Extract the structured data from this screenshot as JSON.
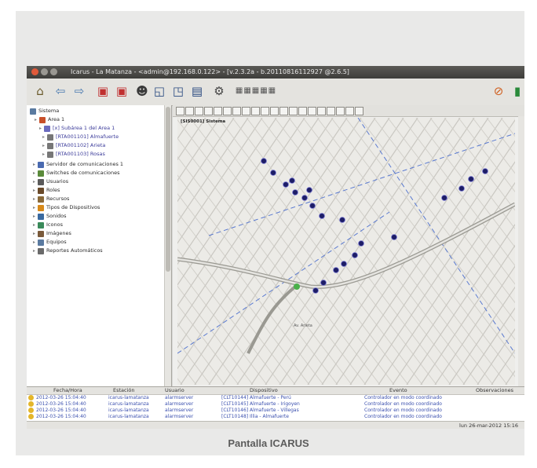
{
  "window": {
    "title": "Icarus - La Matanza - <admin@192.168.0.122> - [v.2.3.2a - b.20110816112927 @2.6.5]",
    "close_color": "#e05a3a",
    "min_color": "#9a9892",
    "max_color": "#9a9892"
  },
  "tree": {
    "root": "Sistema",
    "items": [
      {
        "label": "Area 1",
        "color": "#c8502a"
      },
      {
        "label": "[x] Subárea 1 del Area 1",
        "color": "#6c6cc0"
      },
      {
        "label": "[RTA001101] Almafuerte",
        "color": "#777777"
      },
      {
        "label": "[RTA001102] Arieta",
        "color": "#777777"
      },
      {
        "label": "[RTA001103] Rosas",
        "color": "#777777"
      },
      {
        "label": "Servidor de comunicaciones 1",
        "color": "#4a6ab0"
      },
      {
        "label": "Switches de comunicaciones",
        "color": "#5a8a3a"
      },
      {
        "label": "Usuarios",
        "color": "#5a5a5a"
      },
      {
        "label": "Roles",
        "color": "#6a4a2a"
      },
      {
        "label": "Recursos",
        "color": "#8a6a3a"
      },
      {
        "label": "Tipos de Dispositivos",
        "color": "#d88a1a"
      },
      {
        "label": "Sonidos",
        "color": "#3a6aa0"
      },
      {
        "label": "Iconos",
        "color": "#3a8a5a"
      },
      {
        "label": "Imágenes",
        "color": "#7a5a3a"
      },
      {
        "label": "Equipos",
        "color": "#5a7aa0"
      },
      {
        "label": "Reportes Automáticos",
        "color": "#6a6a6a"
      }
    ]
  },
  "map": {
    "title": "[SIS0001] Sistema",
    "street_label": "Av. Arieta",
    "device_color": "#1d1d66"
  },
  "events": {
    "headers": [
      "Fecha/Hora",
      "Estación",
      "Usuario",
      "Dispositivo",
      "Evento",
      "Observaciones"
    ],
    "rows": [
      {
        "fecha": "2012-03-26 15:04:40",
        "estacion": "icarus-lamatanza",
        "usuario": "alarmserver",
        "dispositivo": "[CLT10144] Almafuerte - Perú",
        "evento": "Controlador en modo coordinado",
        "obs": ""
      },
      {
        "fecha": "2012-03-26 15:04:40",
        "estacion": "icarus-lamatanza",
        "usuario": "alarmserver",
        "dispositivo": "[CLT10145] Almafuerte - Irigoyen",
        "evento": "Controlador en modo coordinado",
        "obs": ""
      },
      {
        "fecha": "2012-03-26 15:04:40",
        "estacion": "icarus-lamatanza",
        "usuario": "alarmserver",
        "dispositivo": "[CLT10146] Almafuerte - Villegas",
        "evento": "Controlador en modo coordinado",
        "obs": ""
      },
      {
        "fecha": "2012-03-26 15:04:40",
        "estacion": "icarus-lamatanza",
        "usuario": "alarmserver",
        "dispositivo": "[CLT10148] Illia - Almafuerte",
        "evento": "Controlador en modo coordinado",
        "obs": ""
      }
    ]
  },
  "status": {
    "datetime": "lun 26-mar-2012 15:16"
  },
  "caption": "Pantalla ICARUS"
}
